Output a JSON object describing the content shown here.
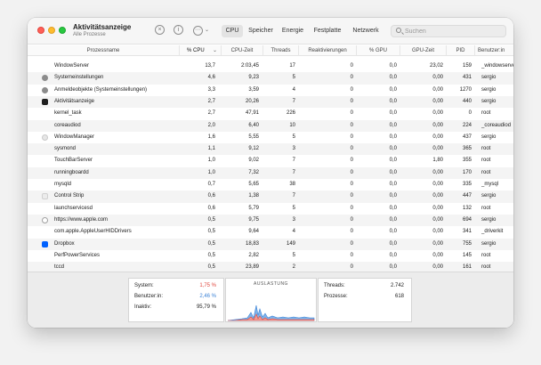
{
  "window": {
    "title": "Aktivitätsanzeige",
    "subtitle": "Alle Prozesse"
  },
  "toolbar": {
    "stop_icon": "stop-process-icon",
    "info_icon": "info-icon",
    "more_icon": "ellipsis-circle-icon",
    "tabs": [
      "CPU",
      "Speicher",
      "Energie",
      "Festplatte",
      "Netzwerk"
    ],
    "active_tab": "CPU",
    "search_placeholder": "Suchen"
  },
  "table": {
    "columns": [
      "Prozessname",
      "% CPU",
      "CPU-Zeit",
      "Threads",
      "Reaktivierungen",
      "% GPU",
      "GPU-Zeit",
      "PID",
      "Benutzer:in"
    ],
    "sorted_column": "% CPU",
    "rows": [
      {
        "name": "WindowServer",
        "cpu": "13,7",
        "time": "2:03,45",
        "threads": "17",
        "wakes": "0",
        "gpu": "0,0",
        "gpu_time": "23,02",
        "pid": "159",
        "user": "_windowserver",
        "icon": ""
      },
      {
        "name": "Systemeinstellungen",
        "cpu": "4,6",
        "time": "9,23",
        "threads": "5",
        "wakes": "0",
        "gpu": "0,0",
        "gpu_time": "0,00",
        "pid": "431",
        "user": "sergio",
        "icon": "gear-icon"
      },
      {
        "name": "Anmeldeobjekte (Systemeinstellungen)",
        "cpu": "3,3",
        "time": "3,59",
        "threads": "4",
        "wakes": "0",
        "gpu": "0,0",
        "gpu_time": "0,00",
        "pid": "1270",
        "user": "sergio",
        "icon": "gear-icon"
      },
      {
        "name": "Aktivitätsanzeige",
        "cpu": "2,7",
        "time": "20,26",
        "threads": "7",
        "wakes": "0",
        "gpu": "0,0",
        "gpu_time": "0,00",
        "pid": "440",
        "user": "sergio",
        "icon": "activity-monitor-icon"
      },
      {
        "name": "kernel_task",
        "cpu": "2,7",
        "time": "47,91",
        "threads": "226",
        "wakes": "0",
        "gpu": "0,0",
        "gpu_time": "0,00",
        "pid": "0",
        "user": "root",
        "icon": ""
      },
      {
        "name": "coreaudiod",
        "cpu": "2,0",
        "time": "6,40",
        "threads": "10",
        "wakes": "0",
        "gpu": "0,0",
        "gpu_time": "0,00",
        "pid": "224",
        "user": "_coreaudiod",
        "icon": ""
      },
      {
        "name": "WindowManager",
        "cpu": "1,6",
        "time": "5,55",
        "threads": "5",
        "wakes": "0",
        "gpu": "0,0",
        "gpu_time": "0,00",
        "pid": "437",
        "user": "sergio",
        "icon": "window-manager-icon"
      },
      {
        "name": "sysmond",
        "cpu": "1,1",
        "time": "9,12",
        "threads": "3",
        "wakes": "0",
        "gpu": "0,0",
        "gpu_time": "0,00",
        "pid": "365",
        "user": "root",
        "icon": ""
      },
      {
        "name": "TouchBarServer",
        "cpu": "1,0",
        "time": "9,02",
        "threads": "7",
        "wakes": "0",
        "gpu": "0,0",
        "gpu_time": "1,80",
        "pid": "355",
        "user": "root",
        "icon": ""
      },
      {
        "name": "runningboardd",
        "cpu": "1,0",
        "time": "7,32",
        "threads": "7",
        "wakes": "0",
        "gpu": "0,0",
        "gpu_time": "0,00",
        "pid": "170",
        "user": "root",
        "icon": ""
      },
      {
        "name": "mysqld",
        "cpu": "0,7",
        "time": "5,65",
        "threads": "38",
        "wakes": "0",
        "gpu": "0,0",
        "gpu_time": "0,00",
        "pid": "335",
        "user": "_mysql",
        "icon": ""
      },
      {
        "name": "Control Strip",
        "cpu": "0,6",
        "time": "1,38",
        "threads": "7",
        "wakes": "0",
        "gpu": "0,0",
        "gpu_time": "0,00",
        "pid": "447",
        "user": "sergio",
        "icon": "control-strip-icon"
      },
      {
        "name": "launchservicesd",
        "cpu": "0,6",
        "time": "5,79",
        "threads": "5",
        "wakes": "0",
        "gpu": "0,0",
        "gpu_time": "0,00",
        "pid": "132",
        "user": "root",
        "icon": ""
      },
      {
        "name": "https://www.apple.com",
        "cpu": "0,5",
        "time": "9,75",
        "threads": "3",
        "wakes": "0",
        "gpu": "0,0",
        "gpu_time": "0,00",
        "pid": "694",
        "user": "sergio",
        "icon": "shield-icon"
      },
      {
        "name": "com.apple.AppleUserHIDDrivers",
        "cpu": "0,5",
        "time": "9,64",
        "threads": "4",
        "wakes": "0",
        "gpu": "0,0",
        "gpu_time": "0,00",
        "pid": "341",
        "user": "_driverkit",
        "icon": ""
      },
      {
        "name": "Dropbox",
        "cpu": "0,5",
        "time": "18,83",
        "threads": "149",
        "wakes": "0",
        "gpu": "0,0",
        "gpu_time": "0,00",
        "pid": "755",
        "user": "sergio",
        "icon": "dropbox-icon"
      },
      {
        "name": "PerfPowerServices",
        "cpu": "0,5",
        "time": "2,82",
        "threads": "5",
        "wakes": "0",
        "gpu": "0,0",
        "gpu_time": "0,00",
        "pid": "145",
        "user": "root",
        "icon": ""
      },
      {
        "name": "tccd",
        "cpu": "0,5",
        "time": "23,89",
        "threads": "2",
        "wakes": "0",
        "gpu": "0,0",
        "gpu_time": "0,00",
        "pid": "161",
        "user": "root",
        "icon": ""
      }
    ]
  },
  "summary": {
    "system_label": "System:",
    "system_value": "1,75 %",
    "user_label": "Benutzer:in:",
    "user_value": "2,46 %",
    "idle_label": "Inaktiv:",
    "idle_value": "95,79 %",
    "graph_title": "AUSLASTUNG",
    "threads_label": "Threads:",
    "threads_value": "2.742",
    "processes_label": "Prozesse:",
    "processes_value": "618"
  },
  "colors": {
    "system": "#e0463c",
    "user": "#3b82d6",
    "active_tab_bg": "#e3e3e3"
  }
}
